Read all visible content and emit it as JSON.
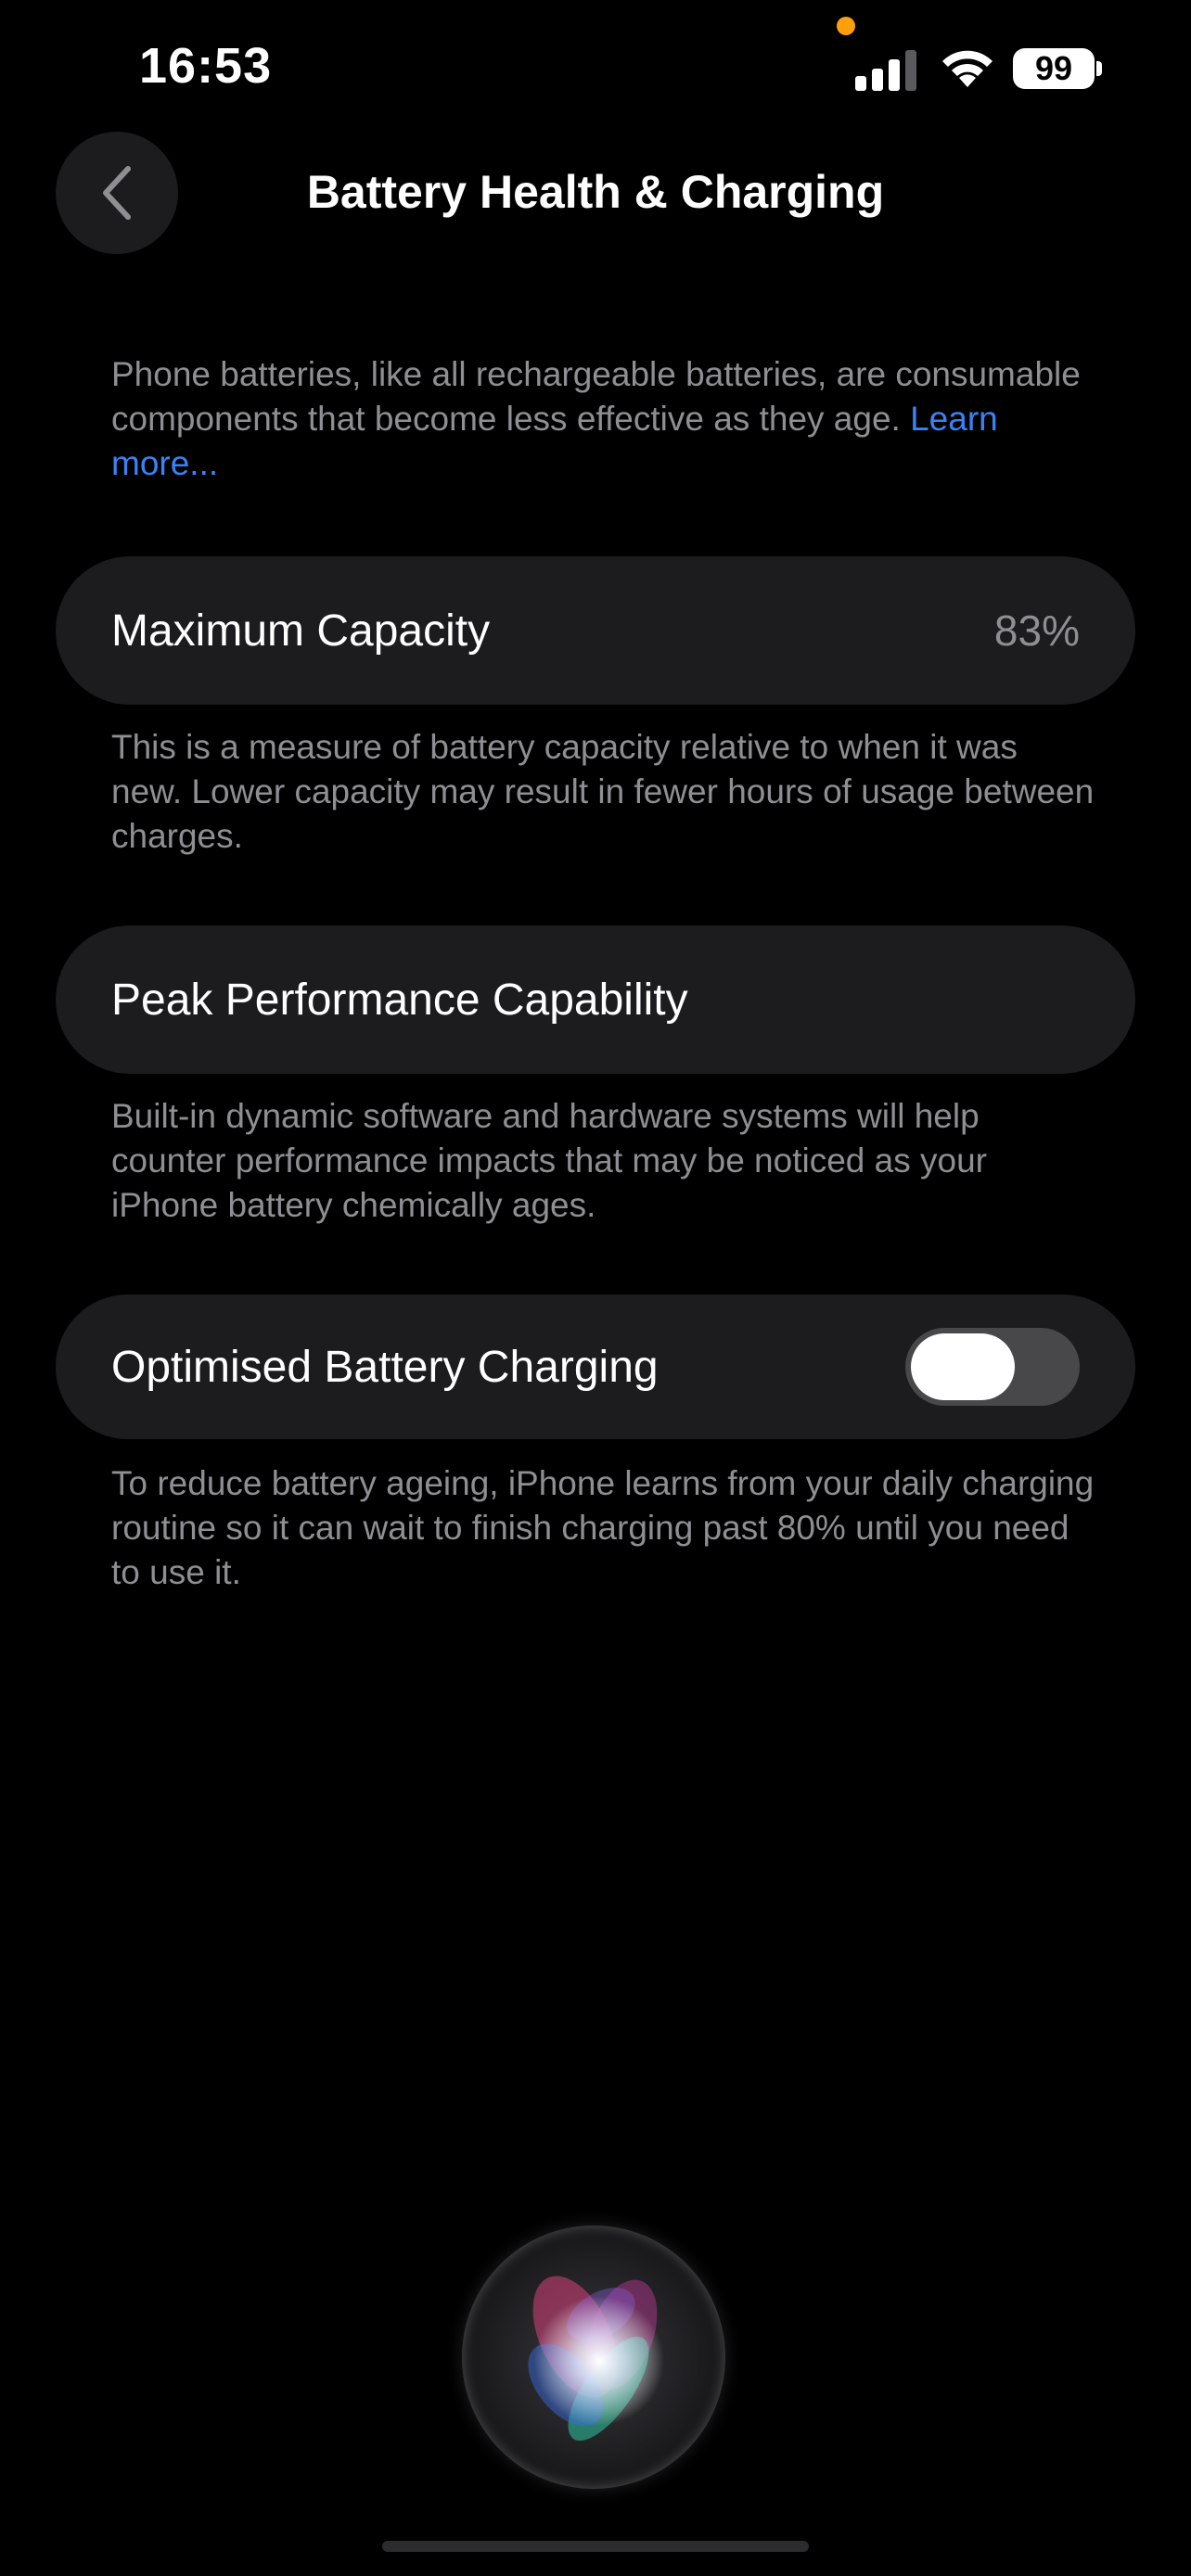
{
  "status_bar": {
    "time": "16:53",
    "battery_level": "99",
    "privacy_dot_color": "#ff9f0a"
  },
  "nav": {
    "title": "Battery Health & Charging"
  },
  "intro": {
    "text": "Phone batteries, like all rechargeable batteries, are consumable components that become less effective as they age.",
    "link": "Learn more..."
  },
  "maximum_capacity": {
    "label": "Maximum Capacity",
    "value": "83%",
    "footnote": "This is a measure of battery capacity relative to when it was new. Lower capacity may result in fewer hours of usage between charges."
  },
  "peak_performance": {
    "label": "Peak Performance Capability",
    "footnote": "Built-in dynamic software and hardware systems will help counter performance impacts that may be noticed as your iPhone battery chemically ages."
  },
  "optimised_charging": {
    "label": "Optimised Battery Charging",
    "toggle_on": false,
    "footnote": "To reduce battery ageing, iPhone learns from your daily charging routine so it can wait to finish charging past 80% until you need to use it."
  },
  "colors": {
    "background": "#000000",
    "cell": "#1c1c1e",
    "secondary_text": "#8e8e93",
    "link": "#3b82f6",
    "toggle_off_track": "#48484a"
  }
}
